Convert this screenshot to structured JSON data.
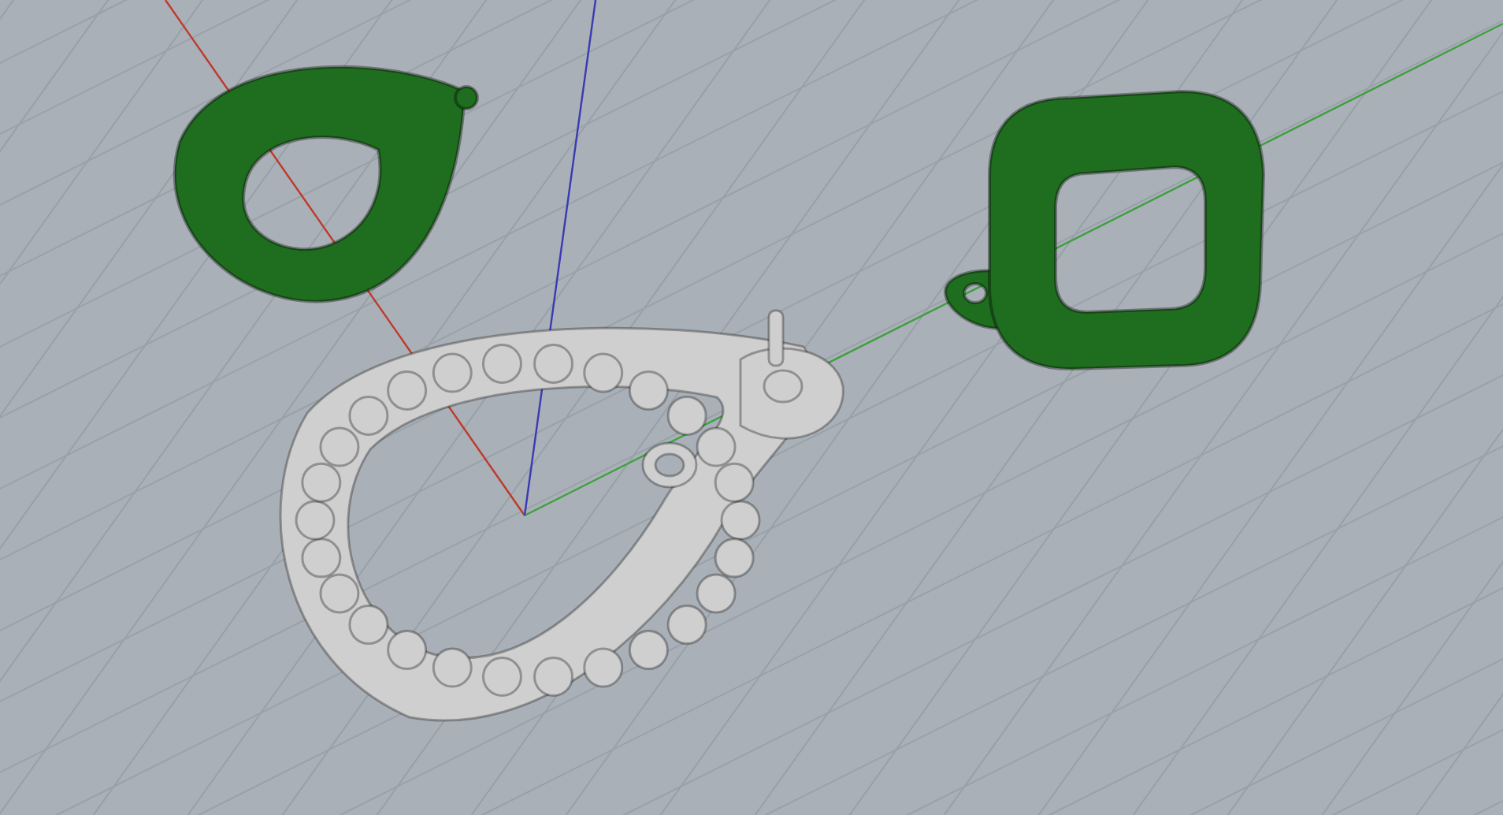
{
  "viewport": {
    "axes": [
      {
        "kind": "x",
        "color": "#c0392b"
      },
      {
        "kind": "y",
        "color": "#3fa03f"
      },
      {
        "kind": "z",
        "color": "#3a3ab4"
      }
    ],
    "models": [
      {
        "kind": "teardrop-bezel",
        "color": "#1f6e1f"
      },
      {
        "kind": "cushion-bezel",
        "color": "#1f6e1f"
      },
      {
        "kind": "teardrop-pendant",
        "color": "#cfcfcf"
      }
    ]
  }
}
